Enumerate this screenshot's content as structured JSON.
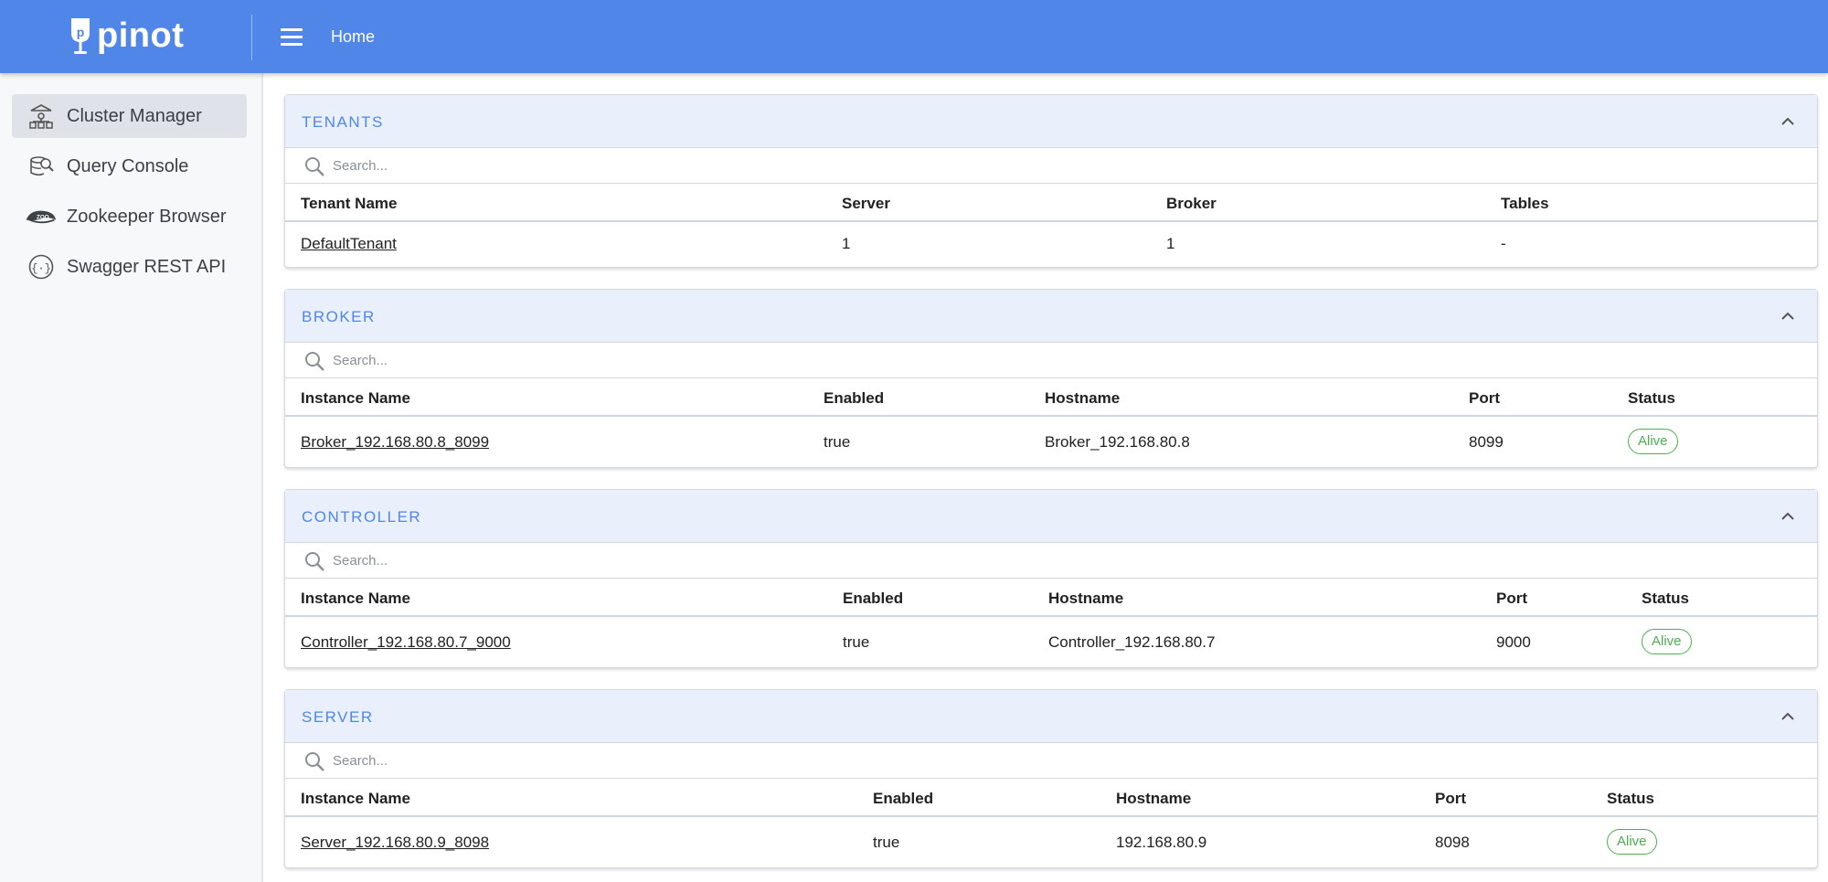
{
  "app": {
    "brand": "pinot",
    "breadcrumb": "Home",
    "accent": "#4f86e8",
    "status_color": "#4caf50"
  },
  "sidebar": {
    "items": [
      {
        "label": "Cluster Manager",
        "icon": "cluster-icon",
        "active": true
      },
      {
        "label": "Query Console",
        "icon": "query-icon",
        "active": false
      },
      {
        "label": "Zookeeper Browser",
        "icon": "zookeeper-icon",
        "active": false
      },
      {
        "label": "Swagger REST API",
        "icon": "swagger-icon",
        "active": false
      }
    ]
  },
  "search_placeholder": "Search...",
  "tenants": {
    "title": "TENANTS",
    "columns": [
      "Tenant Name",
      "Server",
      "Broker",
      "Tables"
    ],
    "rows": [
      {
        "name": "DefaultTenant",
        "server": "1",
        "broker": "1",
        "tables": "-"
      }
    ]
  },
  "broker": {
    "title": "BROKER",
    "columns": [
      "Instance Name",
      "Enabled",
      "Hostname",
      "Port",
      "Status"
    ],
    "rows": [
      {
        "name": "Broker_192.168.80.8_8099",
        "enabled": "true",
        "hostname": "Broker_192.168.80.8",
        "port": "8099",
        "status": "Alive"
      }
    ]
  },
  "controller": {
    "title": "CONTROLLER",
    "columns": [
      "Instance Name",
      "Enabled",
      "Hostname",
      "Port",
      "Status"
    ],
    "rows": [
      {
        "name": "Controller_192.168.80.7_9000",
        "enabled": "true",
        "hostname": "Controller_192.168.80.7",
        "port": "9000",
        "status": "Alive"
      }
    ]
  },
  "server": {
    "title": "SERVER",
    "columns": [
      "Instance Name",
      "Enabled",
      "Hostname",
      "Port",
      "Status"
    ],
    "rows": [
      {
        "name": "Server_192.168.80.9_8098",
        "enabled": "true",
        "hostname": "192.168.80.9",
        "port": "8098",
        "status": "Alive"
      }
    ]
  }
}
